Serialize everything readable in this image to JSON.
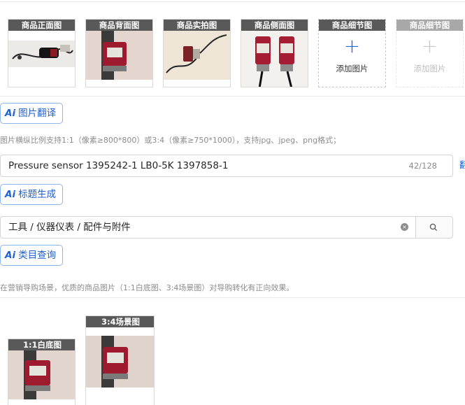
{
  "image_slots": [
    {
      "label": "商品正面图"
    },
    {
      "label": "商品背面图"
    },
    {
      "label": "商品实拍图"
    },
    {
      "label": "商品侧面图"
    },
    {
      "label": "商品细节图",
      "add_label": "添加图片",
      "plus": "+"
    },
    {
      "label": "商品细节图",
      "add_label": "添加图片",
      "plus": "+"
    }
  ],
  "ai_image_translate": {
    "ai": "Ai",
    "label": "图片翻译"
  },
  "image_hint": "图片横纵比例支持1:1（像素≥800*800）或3:4（像素≥750*1000），支持jpg、jpeg、png格式；",
  "title_field": {
    "value": "Pressure sensor 1395242-1 LB0-5K 1397858-1",
    "counter": "42/128",
    "side_char": "翻"
  },
  "ai_title_generate": {
    "ai": "Ai",
    "label": "标题生成"
  },
  "category_field": {
    "value": "工具 / 仪器仪表 / 配件与附件",
    "clear_icon": "×"
  },
  "ai_category_query": {
    "ai": "Ai",
    "label": "类目查询"
  },
  "guide_hint": "在营销导购场景，优质的商品图片（1:1白底图、3:4场景图）对导购转化有正向效果。",
  "scene_images": [
    {
      "label": "1:1白底图"
    },
    {
      "label": "3:4场景图"
    }
  ],
  "colors": {
    "accent": "#1f5fc9",
    "slot_header": "#595959",
    "product_red": "#9e1b2f"
  }
}
